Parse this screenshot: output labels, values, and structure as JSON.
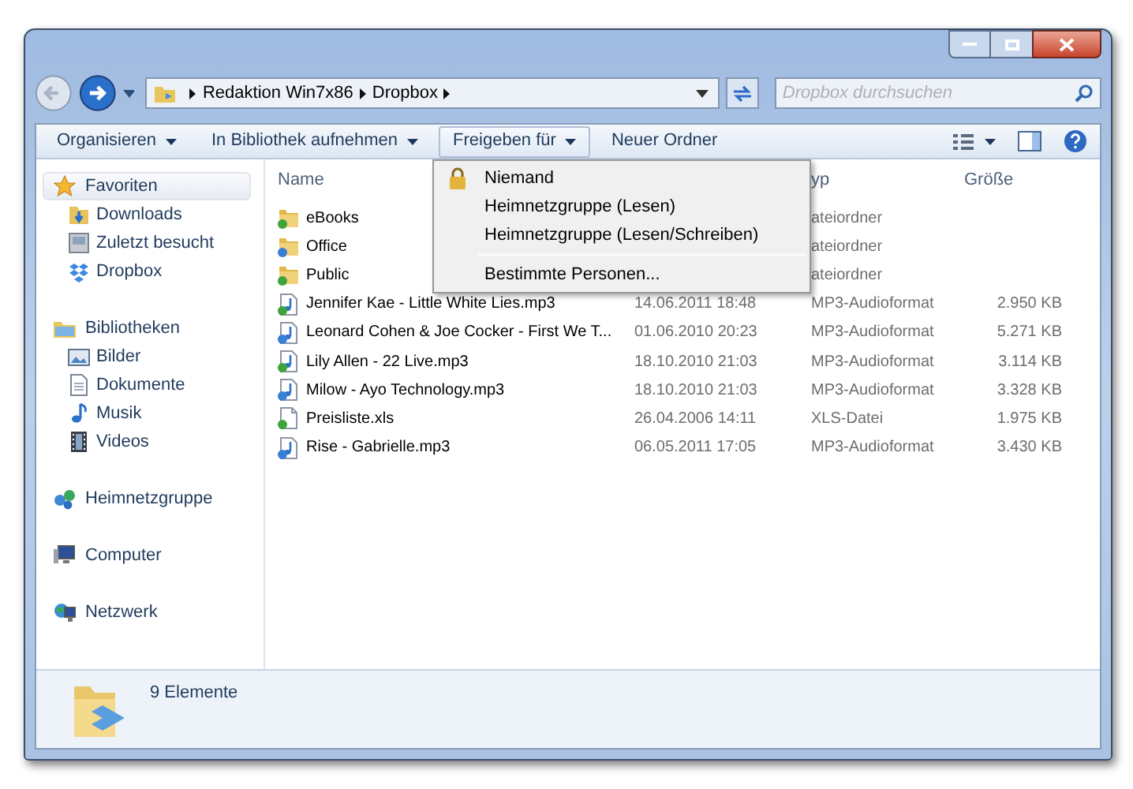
{
  "address": {
    "crumbs": [
      "Redaktion Win7x86",
      "Dropbox"
    ]
  },
  "search": {
    "placeholder": "Dropbox durchsuchen"
  },
  "toolbar": [
    {
      "label": "Organisieren",
      "dropdown": true,
      "selected": false
    },
    {
      "label": "In Bibliothek aufnehmen",
      "dropdown": true,
      "selected": false
    },
    {
      "label": "Freigeben für",
      "dropdown": true,
      "selected": true
    },
    {
      "label": "Neuer Ordner",
      "dropdown": false,
      "selected": false
    }
  ],
  "sidebar": [
    {
      "label": "Favoriten",
      "selected": true,
      "children": [
        {
          "label": "Downloads"
        },
        {
          "label": "Zuletzt besucht"
        },
        {
          "label": "Dropbox"
        }
      ]
    },
    {
      "label": "Bibliotheken",
      "selected": false,
      "children": [
        {
          "label": "Bilder"
        },
        {
          "label": "Dokumente"
        },
        {
          "label": "Musik"
        },
        {
          "label": "Videos"
        }
      ]
    },
    {
      "label": "Heimnetzgruppe",
      "selected": false
    },
    {
      "label": "Computer",
      "selected": false
    },
    {
      "label": "Netzwerk",
      "selected": false
    }
  ],
  "table": {
    "columns": [
      "Name",
      "yp",
      "Größe"
    ],
    "rows": [
      {
        "kind": "folder",
        "synced": true,
        "name": "eBooks",
        "type": "ateiordner"
      },
      {
        "kind": "folder",
        "synced": false,
        "name": "Office",
        "type": "ateiordner"
      },
      {
        "kind": "folder",
        "synced": true,
        "name": "Public",
        "type": "ateiordner"
      },
      {
        "kind": "audio",
        "synced": true,
        "name": "Jennifer Kae - Little White Lies.mp3",
        "date": "14.06.2011 18:48",
        "type": "MP3-Audioformat",
        "size": "2.950 KB"
      },
      {
        "kind": "audio",
        "synced": false,
        "name": "Leonard Cohen & Joe Cocker - First We T...",
        "date": "01.06.2010 20:23",
        "type": "MP3-Audioformat",
        "size": "5.271 KB"
      },
      {
        "kind": "audio",
        "synced": true,
        "name": "Lily Allen - 22 Live.mp3",
        "date": "18.10.2010 21:03",
        "type": "MP3-Audioformat",
        "size": "3.114 KB"
      },
      {
        "kind": "audio",
        "synced": false,
        "name": "Milow - Ayo Technology.mp3",
        "date": "18.10.2010 21:03",
        "type": "MP3-Audioformat",
        "size": "3.328 KB"
      },
      {
        "kind": "document",
        "synced": true,
        "name": "Preisliste.xls",
        "date": "26.04.2006 14:11",
        "type": "XLS-Datei",
        "size": "1.975 KB"
      },
      {
        "kind": "audio",
        "synced": false,
        "name": "Rise - Gabrielle.mp3",
        "date": "06.05.2011 17:05",
        "type": "MP3-Audioformat",
        "size": "3.430 KB"
      }
    ]
  },
  "menu": {
    "sections": [
      [
        "Niemand",
        "Heimnetzgruppe (Lesen)",
        "Heimnetzgruppe (Lesen/Schreiben)"
      ],
      [
        "Bestimmte Personen..."
      ]
    ]
  },
  "status_bar": {
    "text": "9 Elemente"
  }
}
